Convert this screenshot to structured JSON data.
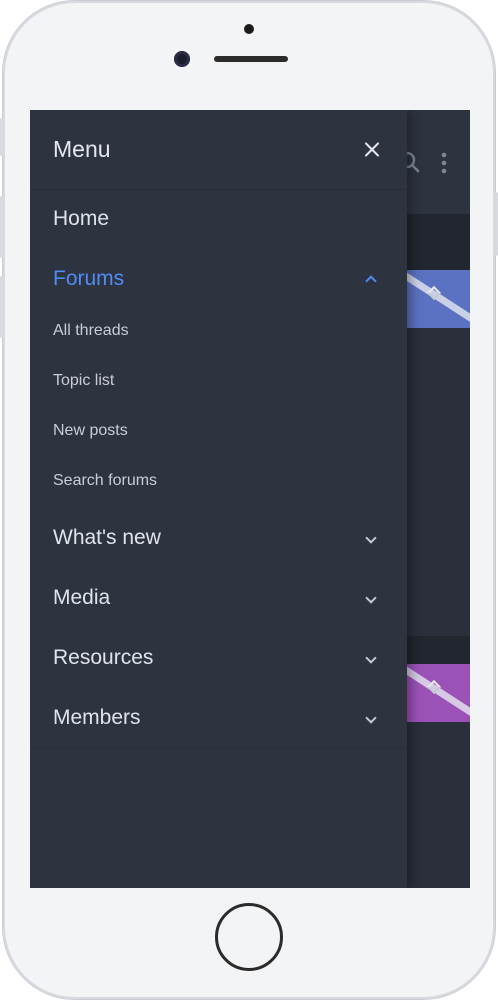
{
  "menu": {
    "title": "Menu",
    "items": [
      {
        "label": "Home"
      },
      {
        "label": "Forums",
        "active": true,
        "expanded": true,
        "children": [
          {
            "label": "All threads"
          },
          {
            "label": "Topic list"
          },
          {
            "label": "New posts"
          },
          {
            "label": "Search forums"
          }
        ]
      },
      {
        "label": "What's new"
      },
      {
        "label": "Media"
      },
      {
        "label": "Resources"
      },
      {
        "label": "Members"
      }
    ]
  },
  "colors": {
    "drawer_bg": "#2e3340",
    "accent": "#4f8cf5",
    "block_blue": "#5b72c2",
    "block_purple": "#9b52b6"
  },
  "icons": [
    "close-icon",
    "chevron-up-icon",
    "chevron-down-icon",
    "search-icon",
    "more-vertical-icon"
  ]
}
